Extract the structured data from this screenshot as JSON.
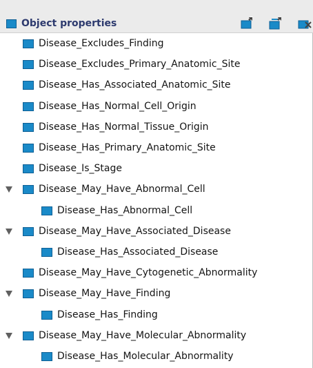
{
  "panel": {
    "title": "Object properties",
    "tools": [
      {
        "name": "add-subproperty-icon"
      },
      {
        "name": "add-sibling-property-icon"
      },
      {
        "name": "delete-property-icon"
      }
    ]
  },
  "tree": {
    "items": [
      {
        "label": "Disease_Excludes_Finding",
        "level": 0,
        "expanded": false
      },
      {
        "label": "Disease_Excludes_Primary_Anatomic_Site",
        "level": 0,
        "expanded": false
      },
      {
        "label": "Disease_Has_Associated_Anatomic_Site",
        "level": 0,
        "expanded": false
      },
      {
        "label": "Disease_Has_Normal_Cell_Origin",
        "level": 0,
        "expanded": false
      },
      {
        "label": "Disease_Has_Normal_Tissue_Origin",
        "level": 0,
        "expanded": false
      },
      {
        "label": "Disease_Has_Primary_Anatomic_Site",
        "level": 0,
        "expanded": false
      },
      {
        "label": "Disease_Is_Stage",
        "level": 0,
        "expanded": false
      },
      {
        "label": "Disease_May_Have_Abnormal_Cell",
        "level": 0,
        "expanded": true
      },
      {
        "label": "Disease_Has_Abnormal_Cell",
        "level": 1,
        "expanded": false
      },
      {
        "label": "Disease_May_Have_Associated_Disease",
        "level": 0,
        "expanded": true
      },
      {
        "label": "Disease_Has_Associated_Disease",
        "level": 1,
        "expanded": false
      },
      {
        "label": "Disease_May_Have_Cytogenetic_Abnormality",
        "level": 0,
        "expanded": false
      },
      {
        "label": "Disease_May_Have_Finding",
        "level": 0,
        "expanded": true
      },
      {
        "label": "Disease_Has_Finding",
        "level": 1,
        "expanded": false
      },
      {
        "label": "Disease_May_Have_Molecular_Abnormality",
        "level": 0,
        "expanded": true
      },
      {
        "label": "Disease_Has_Molecular_Abnormality",
        "level": 1,
        "expanded": false
      }
    ]
  },
  "colors": {
    "property_icon": "#1a8ac8",
    "header_title": "#2d3a6e",
    "header_bg": "#ebebeb"
  }
}
